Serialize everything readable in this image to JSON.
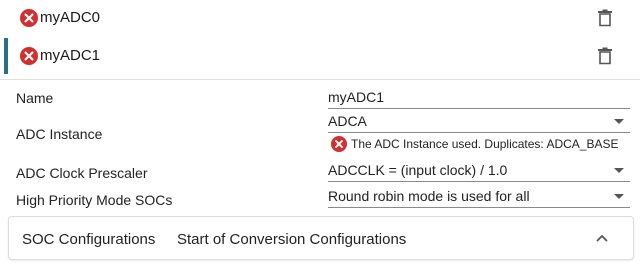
{
  "instances": [
    {
      "name": "myADC0",
      "status_icon": "error-icon",
      "delete_icon": "trash-icon",
      "selected": false
    },
    {
      "name": "myADC1",
      "status_icon": "error-icon",
      "delete_icon": "trash-icon",
      "selected": true
    }
  ],
  "properties": {
    "name": {
      "label": "Name",
      "value": "myADC1"
    },
    "adc_instance": {
      "label": "ADC Instance",
      "value": "ADCA",
      "error": "The ADC Instance used. Duplicates: ADCA_BASE"
    },
    "clock_prescaler": {
      "label": "ADC Clock Prescaler",
      "value": "ADCCLK = (input clock) / 1.0"
    },
    "priority_mode": {
      "label": "High Priority Mode SOCs",
      "value": "Round robin mode is used for all"
    }
  },
  "soc_section": {
    "title": "SOC Configurations",
    "subtitle": "Start of Conversion Configurations",
    "expanded": true
  },
  "colors": {
    "error": "#d32f2f",
    "selection_bar": "#2a6f80",
    "divider": "#e0e0e0"
  }
}
